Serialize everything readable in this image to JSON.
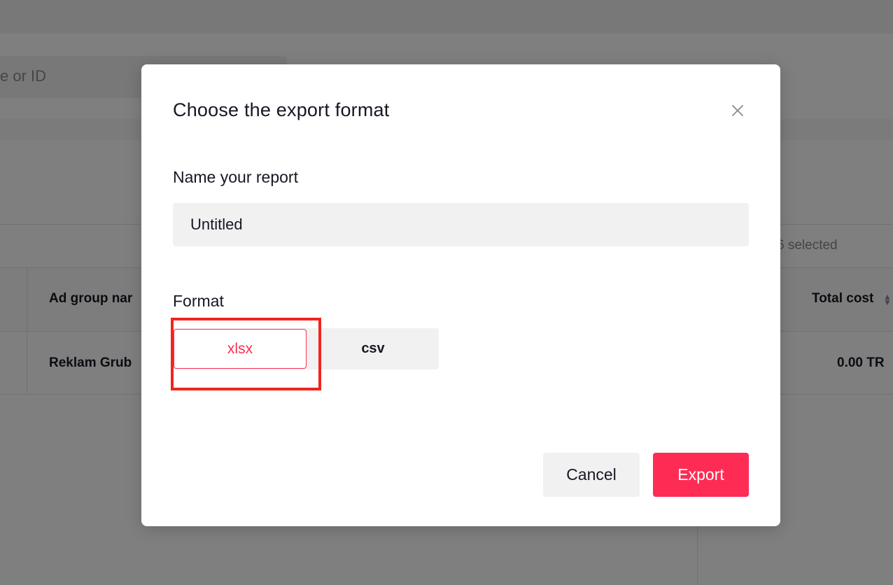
{
  "background": {
    "search_placeholder_partial": "e or ID",
    "selected_count": "6 selected",
    "table": {
      "headers": [
        "Ad group nar",
        "Total cost"
      ],
      "row": [
        "Reklam Grub",
        "0.00 TR"
      ]
    }
  },
  "modal": {
    "title": "Choose the export format",
    "name_label": "Name your report",
    "name_value": "Untitled",
    "format_label": "Format",
    "formats": [
      "xlsx",
      "csv"
    ],
    "selected_format": "xlsx",
    "cancel_label": "Cancel",
    "export_label": "Export"
  },
  "colors": {
    "accent": "#fe2c55",
    "highlight": "#f2251d",
    "input_bg": "#f1f1f2",
    "overlay": "rgba(0,0,0,0.5)"
  },
  "icons": {
    "close": "close-icon",
    "sort": "sort-icon"
  }
}
